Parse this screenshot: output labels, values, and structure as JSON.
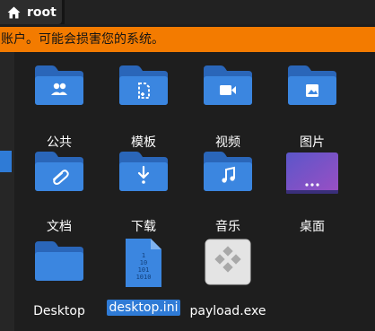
{
  "pathbar": {
    "home_icon": "home-icon",
    "crumb_label": "root"
  },
  "warning": {
    "text": "账户。可能会损害您的系统。"
  },
  "colors": {
    "folder_blue": "#3b86e0",
    "folder_blue_dark": "#2a66b9",
    "warning_orange": "#f37b00",
    "selection_blue": "#2f7bd6"
  },
  "files": [
    {
      "label": "公共",
      "icon": "share-folder-icon"
    },
    {
      "label": "模板",
      "icon": "template-folder-icon"
    },
    {
      "label": "视频",
      "icon": "video-folder-icon"
    },
    {
      "label": "图片",
      "icon": "pictures-folder-icon"
    },
    {
      "label": "文档",
      "icon": "documents-folder-icon"
    },
    {
      "label": "下载",
      "icon": "download-folder-icon"
    },
    {
      "label": "音乐",
      "icon": "music-folder-icon"
    },
    {
      "label": "桌面",
      "icon": "desktop-folder-icon"
    },
    {
      "label": "Desktop",
      "icon": "folder-icon"
    },
    {
      "label": "desktop.ini",
      "icon": "binary-file-icon",
      "selected": true
    },
    {
      "label": "payload.exe",
      "icon": "executable-file-icon"
    }
  ]
}
